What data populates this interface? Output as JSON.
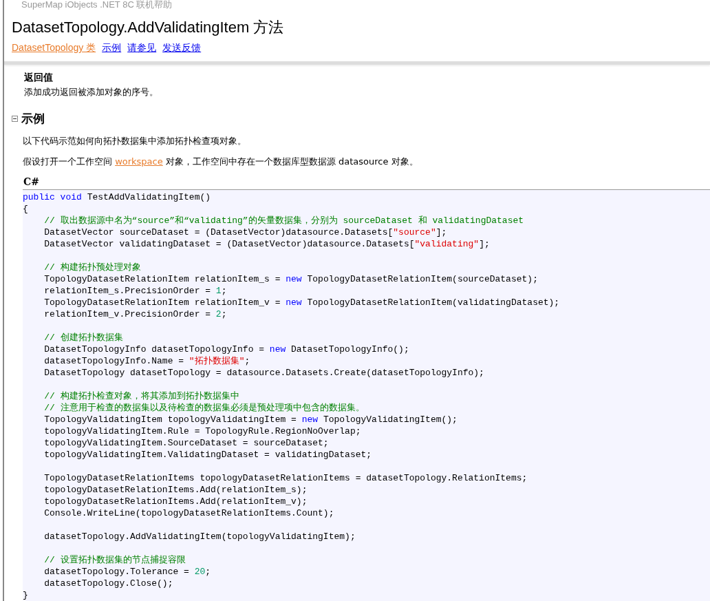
{
  "header": {
    "product": "SuperMap iObjects .NET 8C 联机帮助",
    "title": "DatasetTopology.AddValidatingItem 方法",
    "links": [
      {
        "label": "DatasetTopology 类",
        "visited": true
      },
      {
        "label": "示例",
        "visited": false
      },
      {
        "label": "请参见",
        "visited": false
      },
      {
        "label": "发送反馈",
        "visited": false
      }
    ]
  },
  "return_value": {
    "heading": "返回值",
    "text": "添加成功返回被添加对象的序号。"
  },
  "example": {
    "heading": "示例",
    "expanded": true,
    "paragraphs": [
      [
        {
          "kind": "text",
          "text": "以下代码示范如何向拓扑数据集中添加拓扑检查项对象。"
        }
      ],
      [
        {
          "kind": "text",
          "text": "假设打开一个工作空间 "
        },
        {
          "kind": "link",
          "text": "workspace"
        },
        {
          "kind": "text",
          "text": " 对象，工作空间中存在一个数据库型数据源 datasource 对象。"
        }
      ]
    ],
    "language": "C#",
    "code": [
      [
        {
          "kind": "keyword",
          "text": "public "
        },
        {
          "kind": "keyword",
          "text": "void"
        },
        {
          "kind": "plain",
          "text": " TestAddValidatingItem()"
        }
      ],
      [
        {
          "kind": "plain",
          "text": "{"
        }
      ],
      [
        {
          "kind": "comment",
          "text": "    // 取出数据源中名为“source”和“validating”的矢量数据集，分别为 sourceDataset 和 validatingDataset"
        }
      ],
      [
        {
          "kind": "plain",
          "text": "    DatasetVector sourceDataset = (DatasetVector)datasource.Datasets["
        },
        {
          "kind": "string",
          "text": "\"source\""
        },
        {
          "kind": "plain",
          "text": "];"
        }
      ],
      [
        {
          "kind": "plain",
          "text": "    DatasetVector validatingDataset = (DatasetVector)datasource.Datasets["
        },
        {
          "kind": "string",
          "text": "\"validating\""
        },
        {
          "kind": "plain",
          "text": "];"
        }
      ],
      [
        {
          "kind": "blank"
        }
      ],
      [
        {
          "kind": "comment",
          "text": "    // 构建拓扑预处理对象"
        }
      ],
      [
        {
          "kind": "plain",
          "text": "    TopologyDatasetRelationItem relationItem_s = "
        },
        {
          "kind": "keyword",
          "text": "new"
        },
        {
          "kind": "plain",
          "text": " TopologyDatasetRelationItem(sourceDataset);"
        }
      ],
      [
        {
          "kind": "plain",
          "text": "    relationItem_s.PrecisionOrder = "
        },
        {
          "kind": "number",
          "text": "1"
        },
        {
          "kind": "plain",
          "text": ";"
        }
      ],
      [
        {
          "kind": "plain",
          "text": "    TopologyDatasetRelationItem relationItem_v = "
        },
        {
          "kind": "keyword",
          "text": "new"
        },
        {
          "kind": "plain",
          "text": " TopologyDatasetRelationItem(validatingDataset);"
        }
      ],
      [
        {
          "kind": "plain",
          "text": "    relationItem_v.PrecisionOrder = "
        },
        {
          "kind": "number",
          "text": "2"
        },
        {
          "kind": "plain",
          "text": ";"
        }
      ],
      [
        {
          "kind": "blank"
        }
      ],
      [
        {
          "kind": "comment",
          "text": "    // 创建拓扑数据集"
        }
      ],
      [
        {
          "kind": "plain",
          "text": "    DatasetTopologyInfo datasetTopologyInfo = "
        },
        {
          "kind": "keyword",
          "text": "new"
        },
        {
          "kind": "plain",
          "text": " DatasetTopologyInfo();"
        }
      ],
      [
        {
          "kind": "plain",
          "text": "    datasetTopologyInfo.Name = "
        },
        {
          "kind": "string",
          "text": "\"拓扑数据集\""
        },
        {
          "kind": "plain",
          "text": ";"
        }
      ],
      [
        {
          "kind": "plain",
          "text": "    DatasetTopology datasetTopology = datasource.Datasets.Create(datasetTopologyInfo);"
        }
      ],
      [
        {
          "kind": "blank"
        }
      ],
      [
        {
          "kind": "comment",
          "text": "    // 构建拓扑检查对象，将其添加到拓扑数据集中"
        }
      ],
      [
        {
          "kind": "comment",
          "text": "    // 注意用于检查的数据集以及待检查的数据集必须是预处理项中包含的数据集。"
        }
      ],
      [
        {
          "kind": "plain",
          "text": "    TopologyValidatingItem topologyValidatingItem = "
        },
        {
          "kind": "keyword",
          "text": "new"
        },
        {
          "kind": "plain",
          "text": " TopologyValidatingItem();"
        }
      ],
      [
        {
          "kind": "plain",
          "text": "    topologyValidatingItem.Rule = TopologyRule.RegionNoOverlap;"
        }
      ],
      [
        {
          "kind": "plain",
          "text": "    topologyValidatingItem.SourceDataset = sourceDataset;"
        }
      ],
      [
        {
          "kind": "plain",
          "text": "    topologyValidatingItem.ValidatingDataset = validatingDataset;"
        }
      ],
      [
        {
          "kind": "blank"
        }
      ],
      [
        {
          "kind": "plain",
          "text": "    TopologyDatasetRelationItems topologyDatasetRelationItems = datasetTopology.RelationItems;"
        }
      ],
      [
        {
          "kind": "plain",
          "text": "    topologyDatasetRelationItems.Add(relationItem_s);"
        }
      ],
      [
        {
          "kind": "plain",
          "text": "    topologyDatasetRelationItems.Add(relationItem_v);"
        }
      ],
      [
        {
          "kind": "plain",
          "text": "    Console.WriteLine(topologyDatasetRelationItems.Count);"
        }
      ],
      [
        {
          "kind": "blank"
        }
      ],
      [
        {
          "kind": "plain",
          "text": "    datasetTopology.AddValidatingItem(topologyValidatingItem);"
        }
      ],
      [
        {
          "kind": "blank"
        }
      ],
      [
        {
          "kind": "comment",
          "text": "    // 设置拓扑数据集的节点捕捉容限"
        }
      ],
      [
        {
          "kind": "plain",
          "text": "    datasetTopology.Tolerance = "
        },
        {
          "kind": "number",
          "text": "20"
        },
        {
          "kind": "plain",
          "text": ";"
        }
      ],
      [
        {
          "kind": "plain",
          "text": "    datasetTopology.Close();"
        }
      ],
      [
        {
          "kind": "plain",
          "text": "}"
        }
      ]
    ]
  }
}
